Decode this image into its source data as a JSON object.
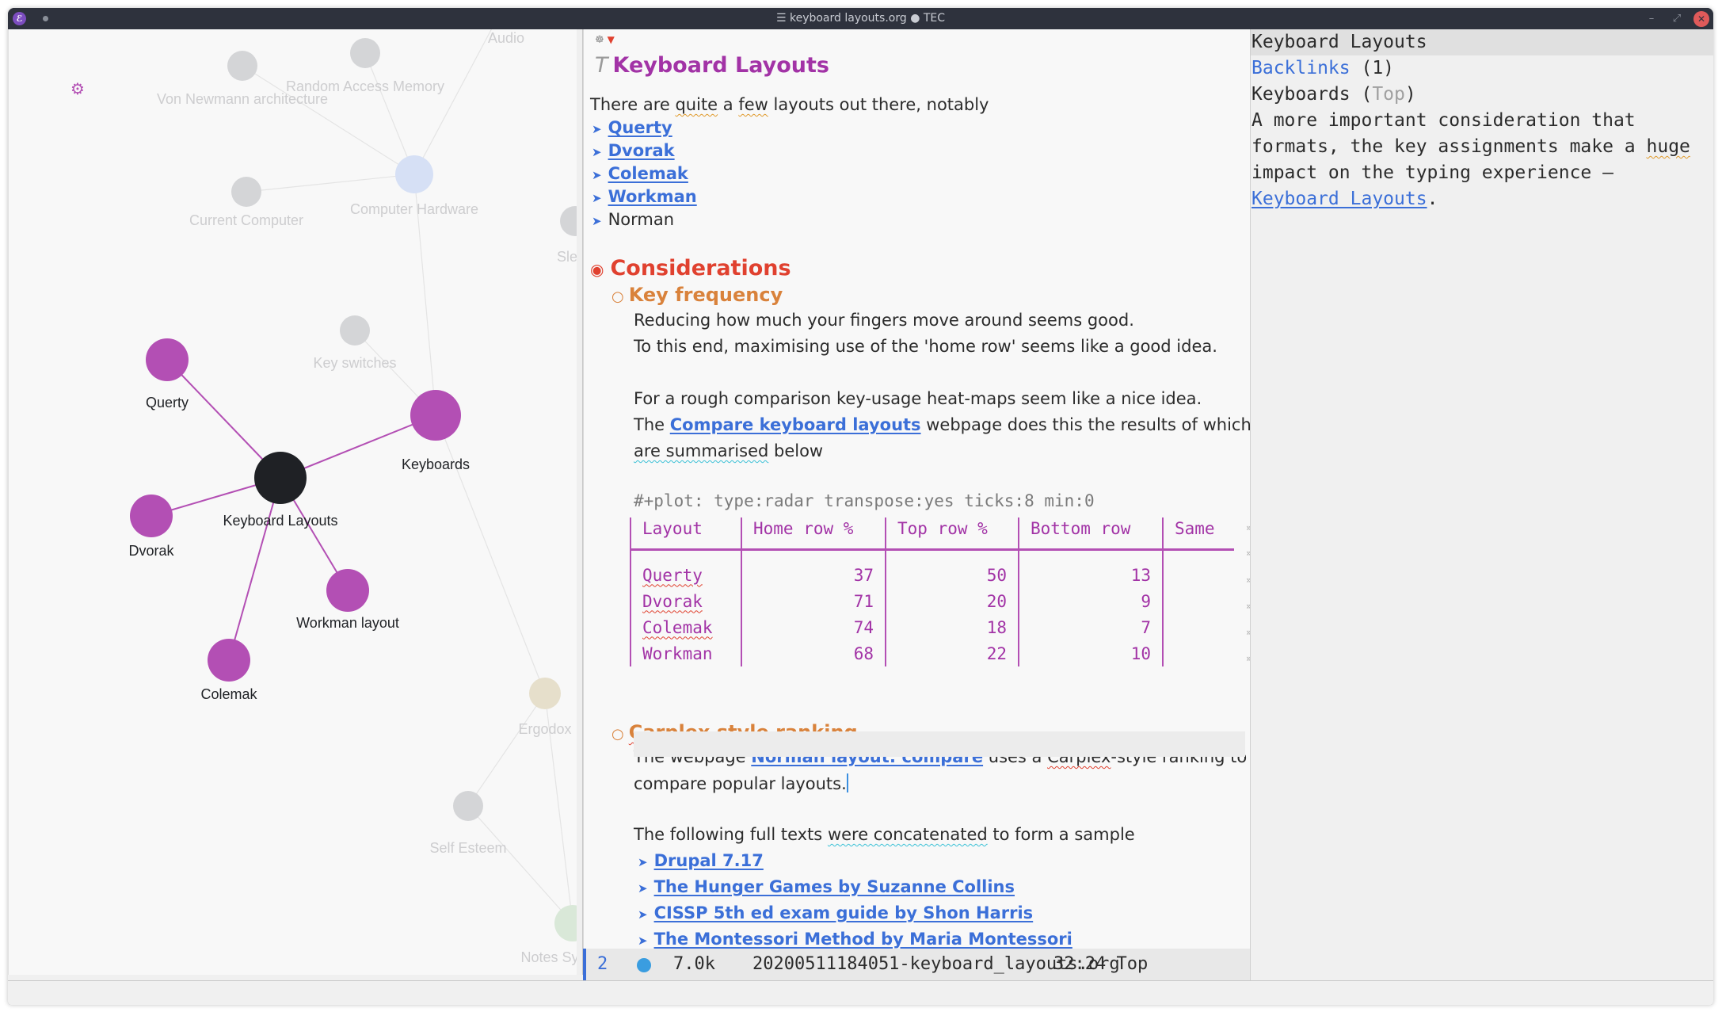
{
  "window": {
    "title": "☰ keyboard layouts.org ● TEC",
    "app_icon_glyph": "ℰ",
    "minimize_glyph": "–",
    "maximize_glyph": "⤢",
    "close_glyph": "✕"
  },
  "graph": {
    "settings_icon": "⚙",
    "accent_color": "#b34fb4",
    "active_color": "#1f2125",
    "dim_node_color": "#d4d5d7",
    "nodes": [
      {
        "id": "von-newmann",
        "label": "Von Newmann architecture",
        "state": "dim"
      },
      {
        "id": "ram",
        "label": "Random Access Memory",
        "state": "dim"
      },
      {
        "id": "audio",
        "label": "Audio",
        "state": "dim"
      },
      {
        "id": "computer-hardware",
        "label": "Computer Hardware",
        "state": "dim-blue"
      },
      {
        "id": "current-computer",
        "label": "Current Computer",
        "state": "dim"
      },
      {
        "id": "sle",
        "label": "Sle",
        "state": "dim"
      },
      {
        "id": "key-switches",
        "label": "Key switches",
        "state": "dim"
      },
      {
        "id": "querty",
        "label": "Querty",
        "state": "linked"
      },
      {
        "id": "keyboards",
        "label": "Keyboards",
        "state": "linked"
      },
      {
        "id": "keyboard-layouts",
        "label": "Keyboard Layouts",
        "state": "active"
      },
      {
        "id": "dvorak",
        "label": "Dvorak",
        "state": "linked"
      },
      {
        "id": "workman",
        "label": "Workman layout",
        "state": "linked"
      },
      {
        "id": "colemak",
        "label": "Colemak",
        "state": "linked"
      },
      {
        "id": "ergodox",
        "label": "Ergodox",
        "state": "dim-tan"
      },
      {
        "id": "self-esteem",
        "label": "Self Esteem",
        "state": "dim"
      },
      {
        "id": "notes-sys",
        "label": "Notes Sy",
        "state": "dim-green"
      }
    ]
  },
  "doc": {
    "header_icons": {
      "gear": "☸",
      "triangle": "▼"
    },
    "title_marker": "T",
    "title": "Keyboard Layouts",
    "intro": {
      "pre": "There are ",
      "w1": "quite",
      "mid": " a ",
      "w2": "few",
      "post": " layouts out there, notably"
    },
    "bullet_glyph": "➤",
    "layouts": [
      {
        "label": "Querty",
        "link": true
      },
      {
        "label": "Dvorak",
        "link": true
      },
      {
        "label": "Colemak",
        "link": true
      },
      {
        "label": "Workman",
        "link": true
      },
      {
        "label": "Norman",
        "link": false
      }
    ],
    "h1_bullet": "◉",
    "h1": "Considerations",
    "h2_bullet": "○",
    "h2_key_frequency": "Key frequency",
    "kf_p1": "Reducing how much your fingers move around seems good.",
    "kf_p2": "To this end, maximising use of the 'home row' seems like a good idea.",
    "kf_p3": "For a rough comparison key-usage heat-maps seem like a nice idea.",
    "kf_p4_pre": "The ",
    "kf_p4_link": "Compare keyboard layouts",
    "kf_p4_post": " webpage does this the results of which",
    "kf_p5_w": "are summarised",
    "kf_p5_post": " below",
    "plot_directive": "#+plot: type:radar transpose:yes ticks:8 min:0",
    "table": {
      "headers": [
        "Layout",
        "Home row %",
        "Top row %",
        "Bottom row",
        "Same"
      ],
      "rows": [
        [
          "Querty",
          "37",
          "50",
          "13",
          ""
        ],
        [
          "Dvorak",
          "71",
          "20",
          "9",
          ""
        ],
        [
          "Colemak",
          "74",
          "18",
          "7",
          ""
        ],
        [
          "Workman",
          "68",
          "22",
          "10",
          ""
        ]
      ],
      "overflow_glyph": "»"
    },
    "h2_carplex_w": "Carplex",
    "h2_carplex_rest": " style ranking",
    "cp_p1_pre": "The webpage ",
    "cp_p1_link": "Norman layout: compare",
    "cp_p1_mid": " uses a ",
    "cp_p1_w": "Carplex",
    "cp_p1_post": "-style ranking to",
    "cp_p2": "compare popular layouts.",
    "samples_pre": "The following full texts ",
    "samples_w": "were concatenated",
    "samples_post": " to form a sample",
    "samples": [
      "Drupal 7.17",
      "The Hunger Games by Suzanne Collins",
      "CISSP 5th ed exam guide by Shon Harris",
      "The Montessori Method by Maria Montessori"
    ]
  },
  "modeline": {
    "window_number": "2",
    "size": "7.0k",
    "filename": "20200511184051-keyboard_layouts.org",
    "position": "32:24 Top"
  },
  "sidebar": {
    "title": "Keyboard Layouts",
    "backlinks_label": "Backlinks",
    "backlinks_count": " (1)",
    "source_title": "Keyboards",
    "source_open": " (",
    "source_pos": "Top",
    "source_close": ")",
    "excerpt_l1": "A more important consideration that",
    "excerpt_l2_pre": "formats, the key assignments make a ",
    "excerpt_l2_w": "huge",
    "excerpt_l3": "impact on the typing experience —",
    "excerpt_link": "Keyboard Layouts",
    "excerpt_end": "."
  }
}
